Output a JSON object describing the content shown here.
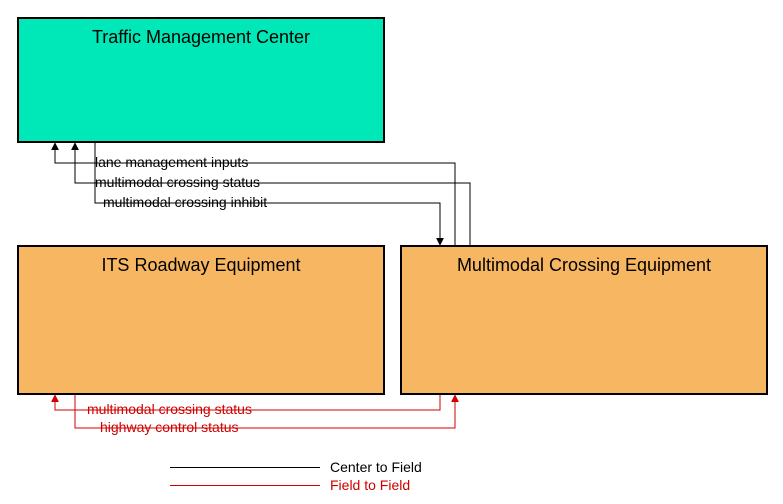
{
  "nodes": {
    "tmc": {
      "label": "Traffic Management Center"
    },
    "its": {
      "label": "ITS Roadway Equipment"
    },
    "mce": {
      "label": "Multimodal Crossing Equipment"
    }
  },
  "flows": {
    "lane_mgmt_inputs": {
      "label": "lane management inputs"
    },
    "mm_crossing_status_tmc": {
      "label": "multimodal crossing status"
    },
    "mm_crossing_inhibit": {
      "label": "multimodal crossing inhibit"
    },
    "mm_crossing_status_its": {
      "label": "multimodal crossing status"
    },
    "highway_control_status": {
      "label": "highway control status"
    }
  },
  "legend": {
    "center_to_field": "Center to Field",
    "field_to_field": "Field to Field"
  }
}
